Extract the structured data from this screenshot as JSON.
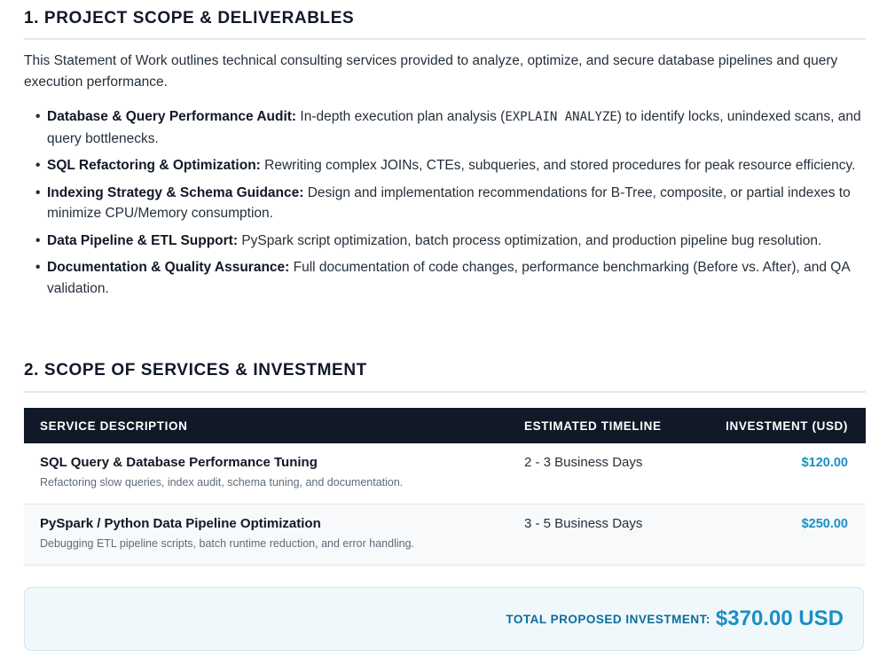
{
  "section1": {
    "title": "1. PROJECT SCOPE & DELIVERABLES",
    "intro": "This Statement of Work outlines technical consulting services provided to analyze, optimize, and secure database pipelines and query execution performance.",
    "items": [
      {
        "bullet": "•",
        "label": "Database & Query Performance Audit:",
        "text_before": " In-depth execution plan analysis (",
        "code": "EXPLAIN ANALYZE",
        "text_after": ") to identify locks, unindexed scans, and query bottlenecks."
      },
      {
        "bullet": "•",
        "label": "SQL Refactoring & Optimization:",
        "text": " Rewriting complex JOINs, CTEs, subqueries, and stored procedures for peak resource efficiency."
      },
      {
        "bullet": "•",
        "label": "Indexing Strategy & Schema Guidance:",
        "text": " Design and implementation recommendations for B-Tree, composite, or partial indexes to minimize CPU/Memory consumption."
      },
      {
        "bullet": "•",
        "label": "Data Pipeline & ETL Support:",
        "text": " PySpark script optimization, batch process optimization, and production pipeline bug resolution."
      },
      {
        "bullet": "•",
        "label": "Documentation & Quality Assurance:",
        "text": " Full documentation of code changes, performance benchmarking (Before vs. After), and QA validation."
      }
    ]
  },
  "section2": {
    "title": "2. SCOPE OF SERVICES & INVESTMENT",
    "columns": [
      "SERVICE DESCRIPTION",
      "ESTIMATED TIMELINE",
      "INVESTMENT (USD)"
    ],
    "rows": [
      {
        "name": "SQL Query & Database Performance Tuning",
        "detail": "Refactoring slow queries, index audit, schema tuning, and documentation.",
        "timeline": "2 - 3 Business Days",
        "price": "$120.00"
      },
      {
        "name": "PySpark / Python Data Pipeline Optimization",
        "detail": "Debugging ETL pipeline scripts, batch runtime reduction, and error handling.",
        "timeline": "3 - 5 Business Days",
        "price": "$250.00"
      }
    ],
    "total_label": "TOTAL PROPOSED INVESTMENT:",
    "total_value": "$370.00 USD"
  },
  "colors": {
    "heading": "#111827",
    "table_header_bg": "#111827",
    "price_accent": "#1c8fc5",
    "total_box_bg": "#f0f8fc",
    "total_label": "#0b6d9a"
  }
}
